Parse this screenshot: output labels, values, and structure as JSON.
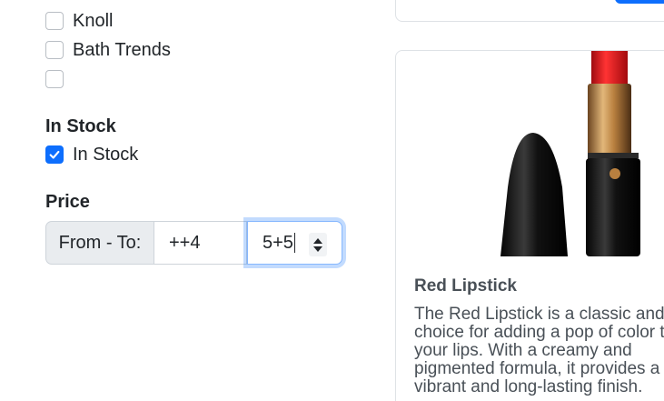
{
  "filters": {
    "brands": [
      {
        "label": "Knoll",
        "checked": false
      },
      {
        "label": "Bath Trends",
        "checked": false
      },
      {
        "label": "",
        "checked": false
      }
    ],
    "stock": {
      "title": "In Stock",
      "option": {
        "label": "In Stock",
        "checked": true
      }
    },
    "price": {
      "title": "Price",
      "prefix": "From - To:",
      "from_value": "++4",
      "to_value": "5+5"
    }
  },
  "product": {
    "title": "Red Lipstick",
    "description": "The Red Lipstick is a classic and choice for adding a pop of color to your lips. With a creamy and pigmented formula, it provides a vibrant and long-lasting finish."
  },
  "colors": {
    "accent": "#0d6efd",
    "focus_ring": "#86b7fe",
    "lipstick_red": "#d01217",
    "gold": "#c8934d"
  },
  "icons": {
    "checkbox_checked": "checkmark-icon",
    "spinner_up": "chevron-up-icon",
    "spinner_down": "chevron-down-icon"
  }
}
